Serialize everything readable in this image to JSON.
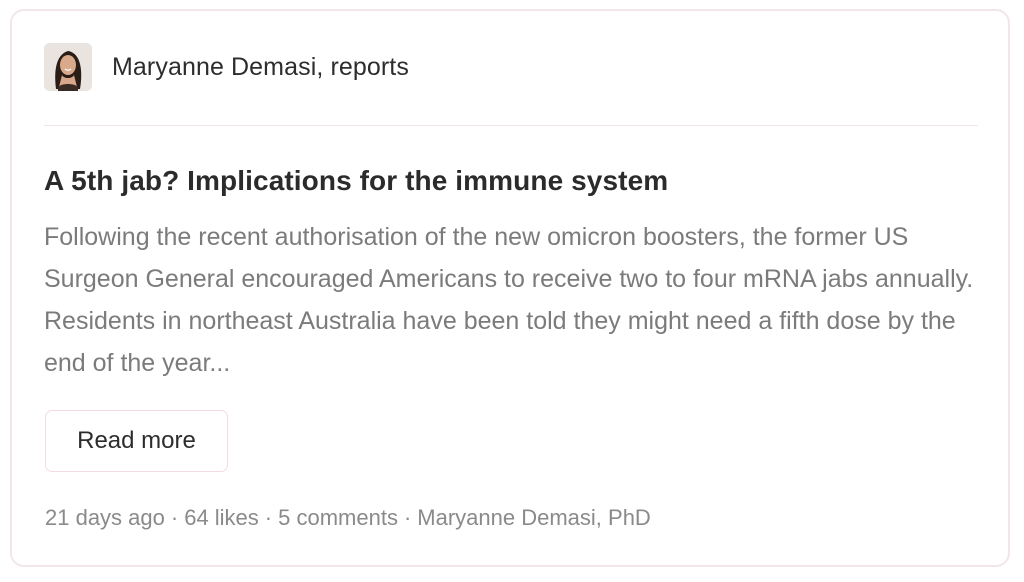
{
  "publication": {
    "name": "Maryanne Demasi, reports",
    "avatar_icon": "author-photo"
  },
  "post": {
    "title": "A 5th jab? Implications for the immune system",
    "excerpt": "Following the recent authorisation of the new omicron boosters, the former US Surgeon General encouraged Americans to receive two to four mRNA jabs annually. Residents in northeast Australia have been told they might need a fifth dose by the end of the year...",
    "read_more_label": "Read more"
  },
  "meta": {
    "age": "21 days ago",
    "likes": "64 likes",
    "comments": "5 comments",
    "author": "Maryanne Demasi, PhD",
    "separator": "·"
  },
  "colors": {
    "card_border": "#f3e6ea",
    "title": "#2b2b2b",
    "excerpt": "#7b7b7b",
    "meta": "#8a8a8a"
  }
}
